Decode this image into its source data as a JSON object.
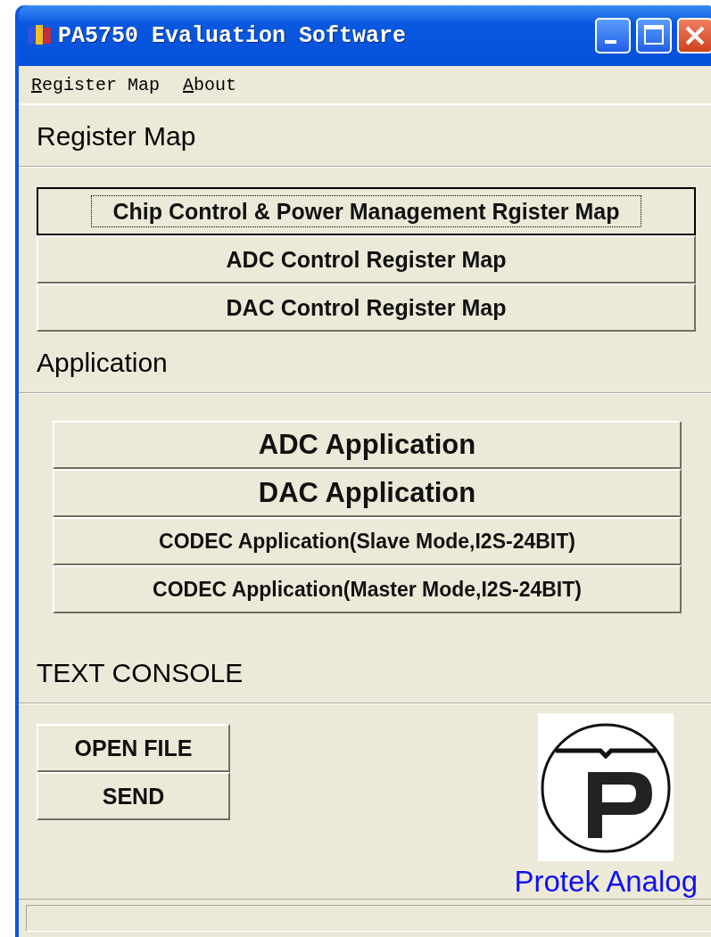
{
  "window": {
    "title": "PA5750 Evaluation Software"
  },
  "menu": [
    {
      "label": "Register Map"
    },
    {
      "label": "About"
    }
  ],
  "sections": [
    {
      "title": "Register Map",
      "kind": "wide",
      "buttons": [
        {
          "label": "Chip Control  & Power Management Rgister Map",
          "focused": true
        },
        {
          "label": "ADC Control Register Map",
          "focused": false
        },
        {
          "label": "DAC Control Register Map",
          "focused": false
        }
      ]
    },
    {
      "title": "Application",
      "kind": "inset",
      "buttons": [
        {
          "label": "ADC Application",
          "kind": "large",
          "focused": false
        },
        {
          "label": "DAC Application",
          "kind": "large",
          "focused": false
        },
        {
          "label": "CODEC Application(Slave Mode,I2S-24BIT)",
          "kind": "small",
          "focused": false
        },
        {
          "label": "CODEC Application(Master Mode,I2S-24BIT)",
          "kind": "small",
          "focused": false
        }
      ]
    }
  ],
  "console": {
    "title": "TEXT CONSOLE",
    "buttons": [
      {
        "label": "OPEN FILE",
        "focused": false
      },
      {
        "label": "SEND",
        "focused": false
      }
    ]
  },
  "logo": {
    "caption": "Protek Analog"
  }
}
